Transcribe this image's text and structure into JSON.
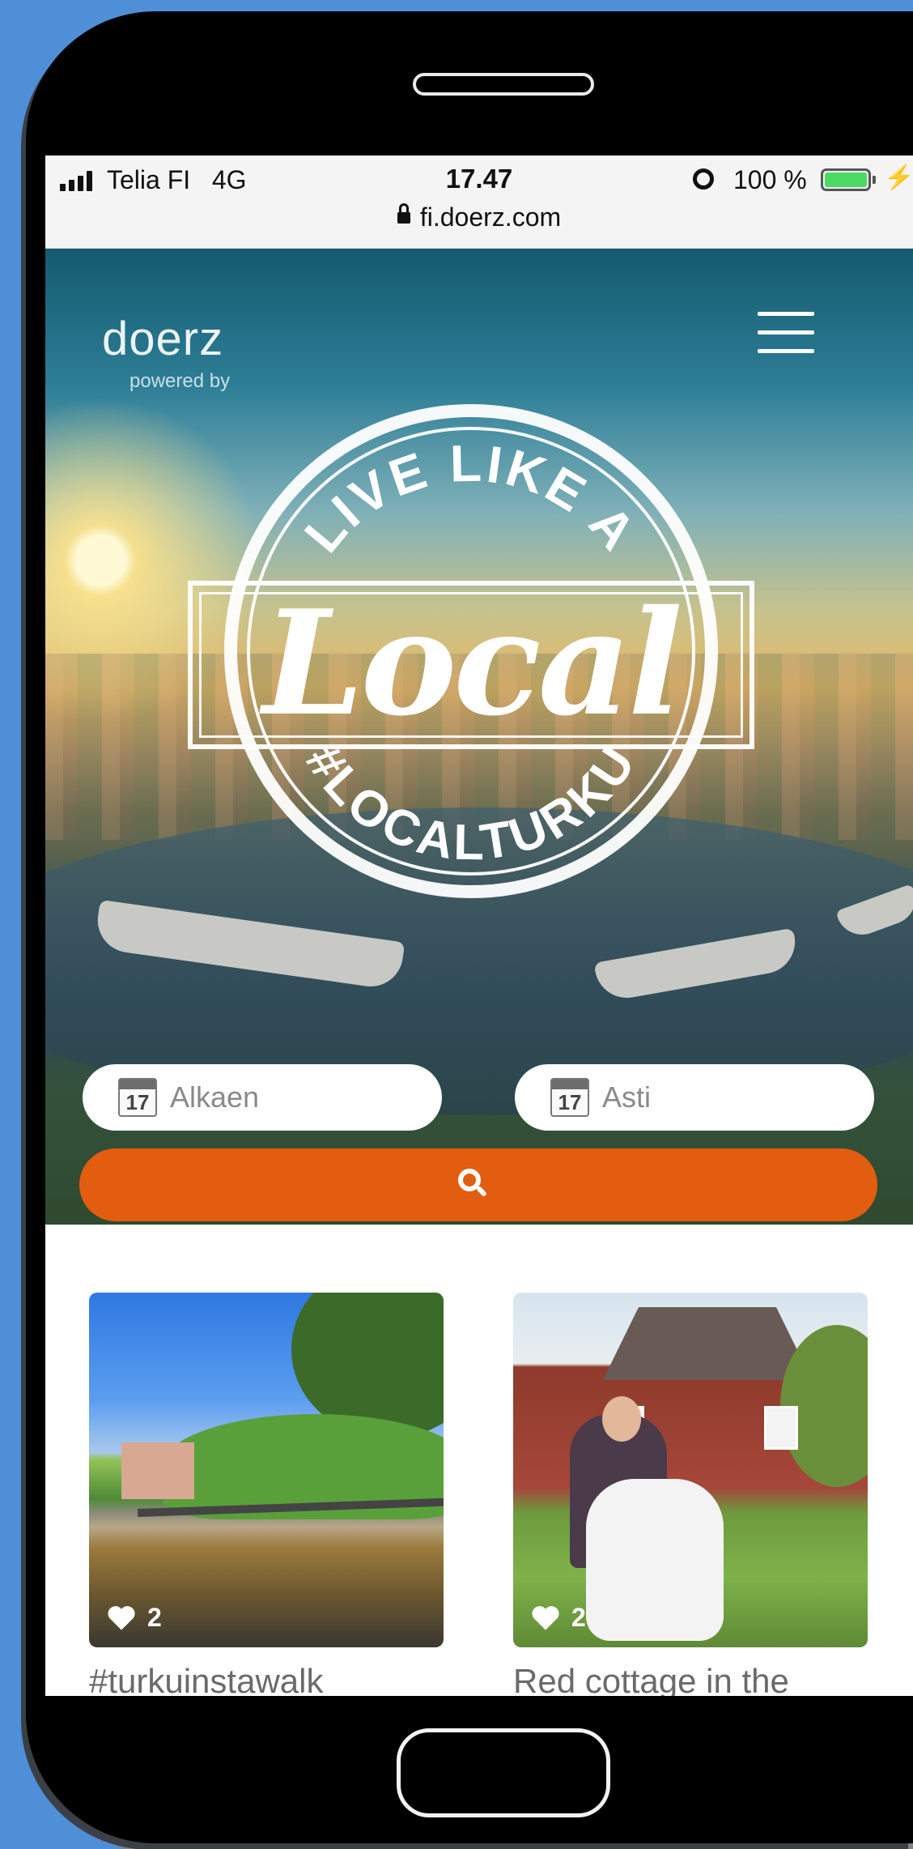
{
  "status_bar": {
    "carrier": "Telia FI",
    "network": "4G",
    "time": "17.47",
    "battery_percent": "100 %",
    "battery_level": 1.0,
    "url": "fi.doerz.com"
  },
  "header": {
    "logo": "doerz",
    "logo_sub": "powered by",
    "menu_icon": "hamburger-menu-icon"
  },
  "hero": {
    "stamp_top": "LIVE LIKE A",
    "stamp_main": "Local",
    "stamp_bottom": "#LOCALTURKU"
  },
  "search": {
    "from_placeholder": "Alkaen",
    "to_placeholder": "Asti",
    "calendar_day": "17",
    "search_icon": "search-icon"
  },
  "cards": [
    {
      "likes": "2",
      "title": "#turkuinstawalk"
    },
    {
      "likes": "2",
      "title": "Red cottage in the"
    }
  ],
  "colors": {
    "accent": "#e35d10",
    "background": "#4f8fd8",
    "battery": "#4cd964"
  }
}
